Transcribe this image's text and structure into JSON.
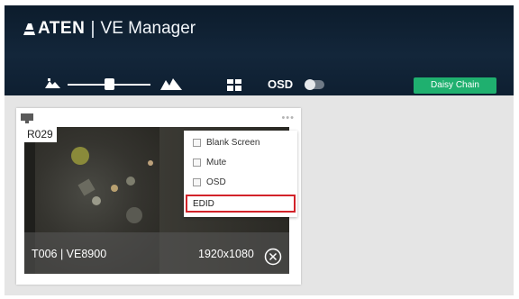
{
  "header": {
    "brand": "ATEN",
    "separator": "|",
    "app_title": "VE Manager",
    "background_color": "#0f2235"
  },
  "toolbar": {
    "zoom_slider_level": 0.5,
    "zoom_out_icon": "small-mountain-icon",
    "zoom_in_icon": "large-mountain-icon",
    "layout_icon": "grid-layout-icon",
    "osd_label": "OSD",
    "osd_enabled": false,
    "daisy_chain_label": "Daisy Chain",
    "daisy_chain_color": "#1fb06f"
  },
  "card": {
    "room_id": "R029",
    "device_label": "T006 | VE8900",
    "resolution": "1920x1080",
    "menu": {
      "items": [
        {
          "label": "Blank Screen",
          "checked": false
        },
        {
          "label": "Mute",
          "checked": false
        },
        {
          "label": "OSD",
          "checked": false
        }
      ],
      "highlighted": {
        "label": "EDID",
        "highlight_color": "#d2232a"
      }
    }
  }
}
